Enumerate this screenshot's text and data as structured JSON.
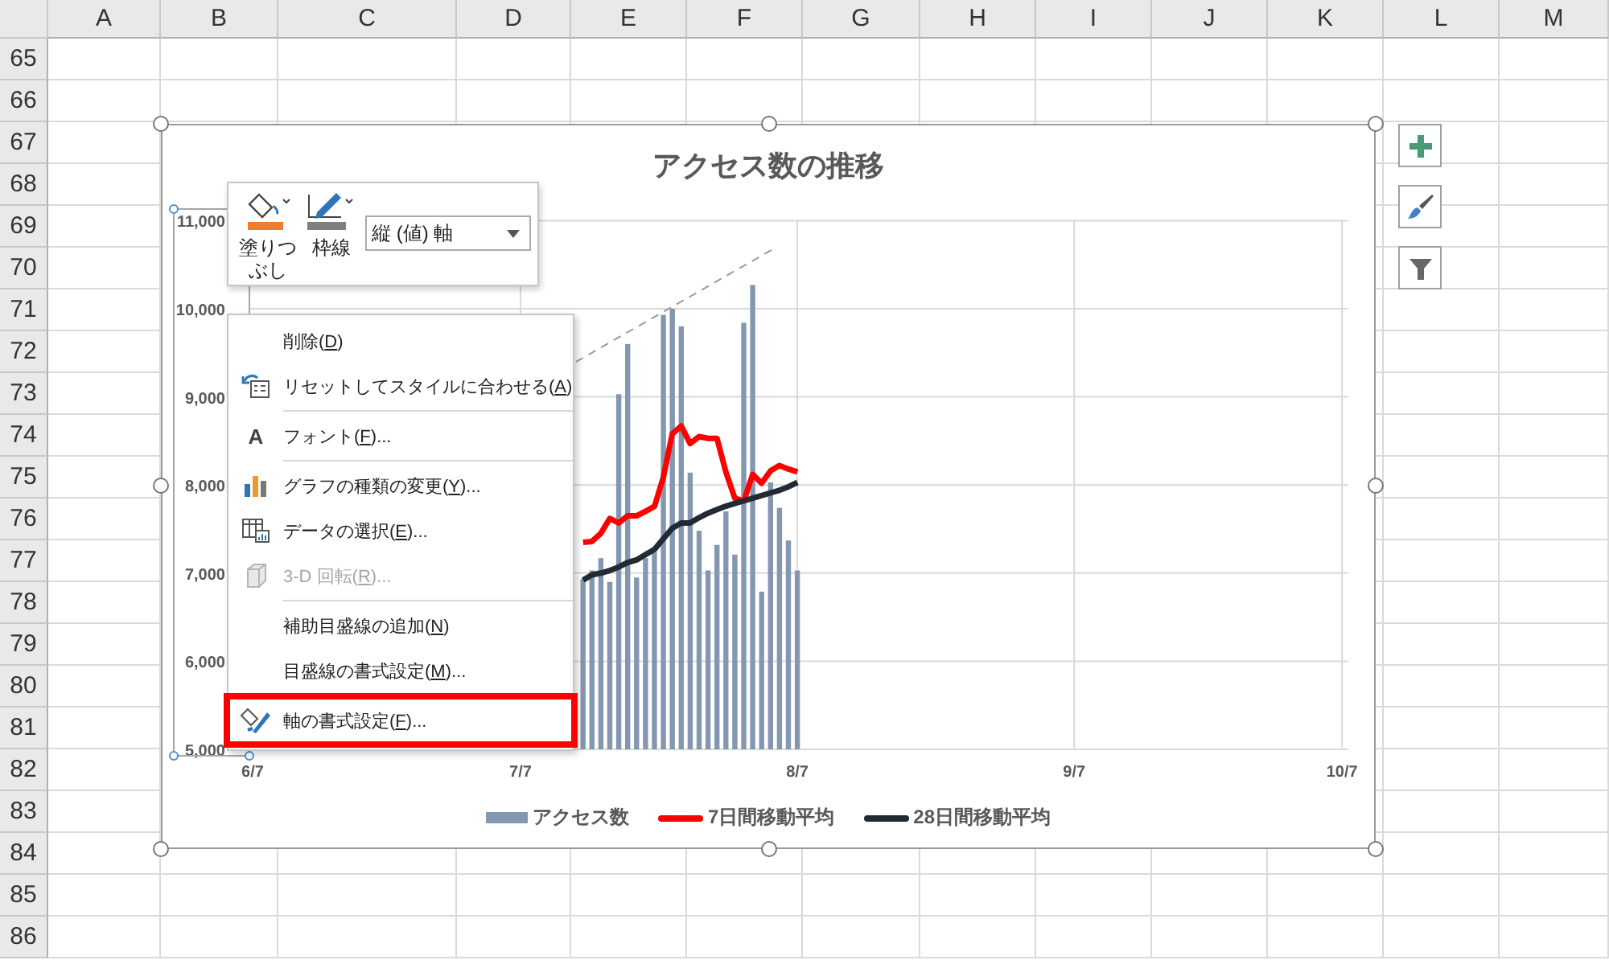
{
  "sheet": {
    "columns": [
      "A",
      "B",
      "C",
      "D",
      "E",
      "F",
      "G",
      "H",
      "I",
      "J",
      "K",
      "L",
      "M"
    ],
    "rows": [
      "65",
      "66",
      "67",
      "68",
      "69",
      "70",
      "71",
      "72",
      "73",
      "74",
      "75",
      "76",
      "77",
      "78",
      "79",
      "80",
      "81",
      "82",
      "83",
      "84",
      "85",
      "86"
    ]
  },
  "chart": {
    "chart_data": {
      "type": "bar",
      "title": "アクセス数の推移",
      "categories": [
        "6/7",
        null,
        null,
        null,
        null,
        null,
        null,
        null,
        null,
        null,
        null,
        null,
        null,
        null,
        null,
        null,
        null,
        null,
        null,
        null,
        null,
        null,
        null,
        null,
        null,
        null,
        null,
        null,
        null,
        null,
        "7/7",
        null,
        null,
        null,
        null,
        null,
        null,
        null,
        null,
        null,
        null,
        null,
        null,
        null,
        null,
        null,
        null,
        null,
        null,
        null,
        null,
        null,
        null,
        null,
        null,
        null,
        null,
        null,
        null,
        null,
        null,
        "8/7",
        null,
        null,
        null,
        null,
        null,
        null,
        null,
        null,
        null,
        null,
        null,
        null,
        null,
        null,
        null,
        null,
        null,
        null,
        null,
        null,
        null,
        null,
        null,
        null,
        null,
        null,
        null,
        null,
        null,
        null,
        "9/7",
        null,
        null,
        null,
        null,
        null,
        null,
        null,
        null,
        null,
        null,
        null,
        null,
        null,
        null,
        null,
        null,
        null,
        null,
        null,
        null,
        null,
        null,
        null,
        null,
        null,
        null,
        null,
        null,
        null,
        "10/7"
      ],
      "ylim": [
        5000,
        11000
      ],
      "grid": true,
      "legend": "bottom",
      "yticks": [
        {
          "value": 5000,
          "label": "5,000"
        },
        {
          "value": 6000,
          "label": "6,000"
        },
        {
          "value": 7000,
          "label": "7,000"
        },
        {
          "value": 8000,
          "label": "8,000"
        },
        {
          "value": 9000,
          "label": "9,000"
        },
        {
          "value": 10000,
          "label": "10,000"
        },
        {
          "value": 11000,
          "label": "11,000"
        }
      ],
      "series": [
        {
          "name": "アクセス数",
          "type": "bar",
          "color": "#8497b0",
          "values": [
            null,
            null,
            null,
            null,
            null,
            null,
            null,
            null,
            null,
            null,
            null,
            null,
            null,
            null,
            null,
            null,
            null,
            null,
            null,
            null,
            null,
            null,
            null,
            null,
            null,
            null,
            null,
            null,
            null,
            null,
            null,
            null,
            null,
            null,
            null,
            null,
            null,
            6930,
            7030,
            7170,
            6900,
            9030,
            9600,
            6950,
            7170,
            7240,
            9930,
            10000,
            9800,
            8140,
            7480,
            7030,
            7320,
            7700,
            7210,
            9840,
            10270,
            6790,
            8030,
            7740,
            7370,
            7030,
            null,
            null,
            null,
            null,
            null,
            null,
            null,
            null,
            null,
            null,
            null,
            null,
            null,
            null,
            null,
            null,
            null,
            null,
            null,
            null,
            null,
            null,
            null,
            null,
            null,
            null,
            null,
            null,
            null,
            null,
            null,
            null,
            null,
            null,
            null,
            null,
            null,
            null,
            null,
            null,
            null,
            null,
            null,
            null,
            null,
            null,
            null,
            null,
            null,
            null,
            null,
            null,
            null,
            null,
            null,
            null,
            null,
            null,
            null,
            null,
            null
          ]
        },
        {
          "name": "7日間移動平均",
          "type": "line",
          "color": "#ff0000",
          "values": [
            null,
            null,
            null,
            null,
            null,
            null,
            null,
            null,
            null,
            null,
            null,
            null,
            null,
            null,
            null,
            null,
            null,
            null,
            null,
            null,
            null,
            null,
            null,
            null,
            null,
            null,
            null,
            null,
            null,
            null,
            null,
            null,
            null,
            null,
            null,
            null,
            null,
            7350,
            7360,
            7450,
            7620,
            7570,
            7650,
            7650,
            7700,
            7760,
            8090,
            8580,
            8670,
            8470,
            8550,
            8530,
            8530,
            8150,
            7850,
            7820,
            8120,
            8020,
            8160,
            8220,
            8180,
            8150,
            null,
            null,
            null,
            null,
            null,
            null,
            null,
            null,
            null,
            null,
            null,
            null,
            null,
            null,
            null,
            null,
            null,
            null,
            null,
            null,
            null,
            null,
            null,
            null,
            null,
            null,
            null,
            null,
            null,
            null,
            null,
            null,
            null,
            null,
            null,
            null,
            null,
            null,
            null,
            null,
            null,
            null,
            null,
            null,
            null,
            null,
            null,
            null,
            null,
            null,
            null,
            null,
            null,
            null,
            null,
            null,
            null,
            null,
            null,
            null,
            null
          ]
        },
        {
          "name": "28日間移動平均",
          "type": "line",
          "color": "#222a35",
          "values": [
            null,
            null,
            null,
            null,
            null,
            null,
            null,
            null,
            null,
            null,
            null,
            null,
            null,
            null,
            null,
            null,
            null,
            null,
            null,
            null,
            null,
            null,
            null,
            null,
            null,
            null,
            null,
            null,
            null,
            null,
            null,
            null,
            null,
            null,
            null,
            null,
            null,
            6920,
            6980,
            7000,
            7030,
            7070,
            7120,
            7150,
            7210,
            7270,
            7390,
            7510,
            7570,
            7570,
            7630,
            7680,
            7720,
            7760,
            7790,
            7820,
            7850,
            7880,
            7910,
            7940,
            7980,
            8030,
            null,
            null,
            null,
            null,
            null,
            null,
            null,
            null,
            null,
            null,
            null,
            null,
            null,
            null,
            null,
            null,
            null,
            null,
            null,
            null,
            null,
            null,
            null,
            null,
            null,
            null,
            null,
            null,
            null,
            null,
            null,
            null,
            null,
            null,
            null,
            null,
            null,
            null,
            null,
            null,
            null,
            null,
            null,
            null,
            null,
            null,
            null,
            null,
            null,
            null,
            null,
            null,
            null,
            null,
            null,
            null,
            null,
            null,
            null,
            null,
            null
          ]
        }
      ]
    }
  },
  "mini_toolbar": {
    "buttons": [
      {
        "kind": "fill",
        "label": "塗りつぶし"
      },
      {
        "kind": "outline",
        "label": "枠線"
      }
    ],
    "dropdown": {
      "value": "縦 (値) 軸"
    }
  },
  "context_menu": [
    {
      "kind": "plain",
      "text": "削除(",
      "mnemonic": "D",
      "tail": ")",
      "disabled": false,
      "highlighted": false,
      "separator_after": false
    },
    {
      "kind": "reset",
      "text": "リセットしてスタイルに合わせる(",
      "mnemonic": "A",
      "tail": ")",
      "disabled": false,
      "highlighted": false,
      "separator_after": true
    },
    {
      "kind": "font",
      "icon_text": "A",
      "text": "フォント(",
      "mnemonic": "F",
      "tail": ")...",
      "disabled": false,
      "highlighted": false,
      "separator_after": true
    },
    {
      "kind": "chart-type",
      "text": "グラフの種類の変更(",
      "mnemonic": "Y",
      "tail": ")...",
      "disabled": false,
      "highlighted": false,
      "separator_after": false
    },
    {
      "kind": "data",
      "text": "データの選択(",
      "mnemonic": "E",
      "tail": ")...",
      "disabled": false,
      "highlighted": false,
      "separator_after": false
    },
    {
      "kind": "rotate",
      "text": "3-D 回転(",
      "mnemonic": "R",
      "tail": ")...",
      "disabled": true,
      "highlighted": false,
      "separator_after": true
    },
    {
      "kind": "plain",
      "text": "補助目盛線の追加(",
      "mnemonic": "N",
      "tail": ")",
      "disabled": false,
      "highlighted": false,
      "separator_after": false
    },
    {
      "kind": "plain",
      "text": "目盛線の書式設定(",
      "mnemonic": "M",
      "tail": ")...",
      "disabled": false,
      "highlighted": false,
      "separator_after": false
    },
    {
      "kind": "format",
      "text": "軸の書式設定(",
      "mnemonic": "F",
      "tail": ")...",
      "disabled": false,
      "highlighted": true,
      "separator_after": false
    }
  ]
}
